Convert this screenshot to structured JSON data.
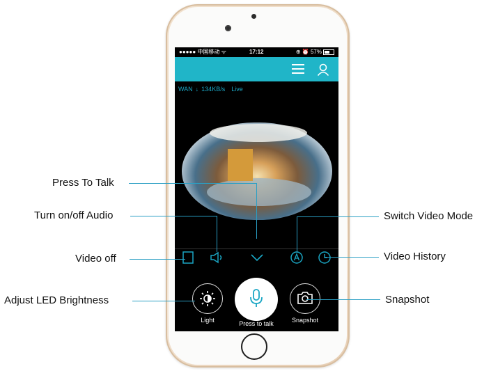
{
  "status_bar": {
    "carrier": "●●●●● 中国移动 ᯤ",
    "time": "17:12",
    "battery": "⊕ ⏰ 57%",
    "battery_level": 0.57
  },
  "stream_info": {
    "network": "WAN",
    "arrow": "↓",
    "speed": "134KB/s",
    "state": "Live"
  },
  "controls": {
    "light_label": "Light",
    "talk_label": "Press to talk",
    "snapshot_label": "Snapshot"
  },
  "callouts": {
    "press_to_talk": "Press To Talk",
    "audio": "Turn on/off Audio",
    "video_off": "Video off",
    "led": "Adjust LED Brightness",
    "switch_mode": "Switch Video Mode",
    "history": "Video History",
    "snapshot": "Snapshot"
  },
  "colors": {
    "accent": "#20b5c8",
    "callout_line": "#2a9fc4"
  },
  "icons": [
    "menu-icon",
    "user-icon",
    "video-off-icon",
    "speaker-icon",
    "chevron-down-icon",
    "auto-mode-icon",
    "history-icon",
    "brightness-icon",
    "microphone-icon",
    "camera-icon"
  ]
}
